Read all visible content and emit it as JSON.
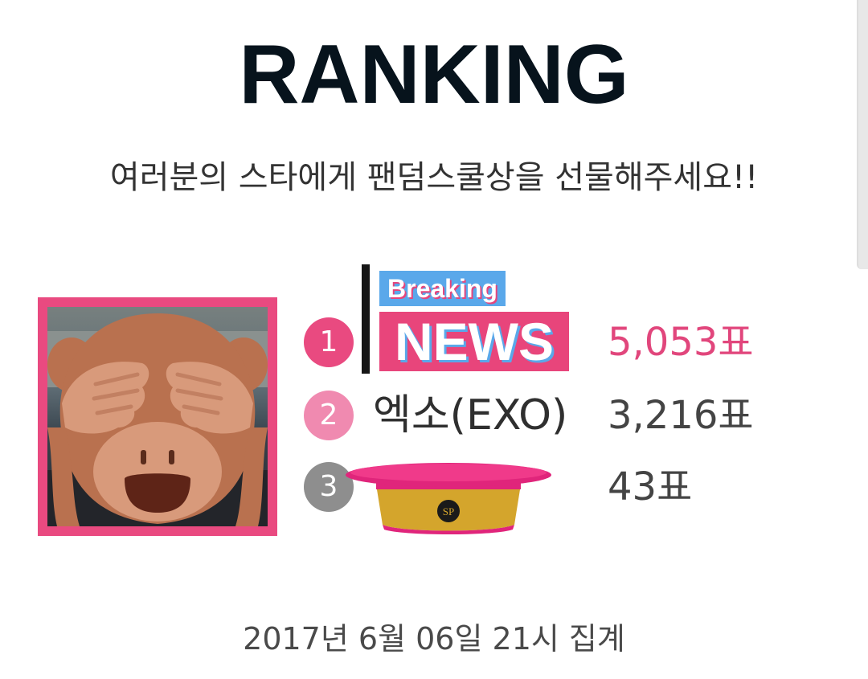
{
  "header": {
    "title": "RANKING",
    "subtitle": "여러분의 스타에게 팬덤스쿨상을 선물해주세요!!"
  },
  "ranking": [
    {
      "rank": "1",
      "name": "",
      "votes": "5,053표",
      "badge_color": "#e94a80"
    },
    {
      "rank": "2",
      "name": "엑소(EXO)",
      "votes": "3,216표",
      "badge_color": "#f08ab0"
    },
    {
      "rank": "3",
      "name": "",
      "votes": "43표",
      "badge_color": "#8e8e8e"
    }
  ],
  "stickers": {
    "monkey": "see-no-evil-monkey-icon",
    "breaking": "Breaking",
    "news": "NEWS",
    "hat": "pink-cap-icon",
    "hat_badge": "SP"
  },
  "footer": {
    "timestamp": "2017년 6월 06일 21시 집계"
  },
  "colors": {
    "accent_pink": "#e94a80",
    "title": "#07131c",
    "news_blue": "#5aa8ea"
  }
}
